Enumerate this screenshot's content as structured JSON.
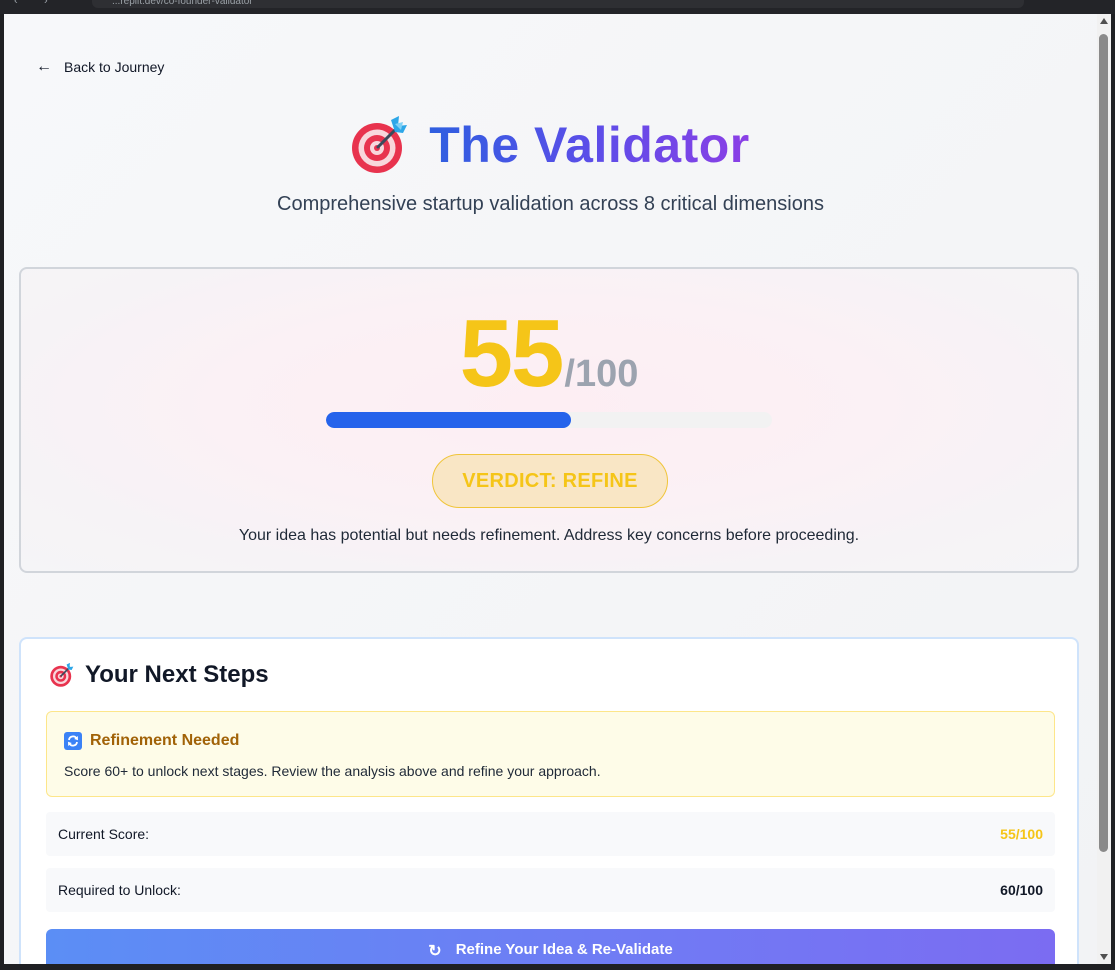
{
  "browser": {
    "url": "...replit.dev/co-founder-validator"
  },
  "nav": {
    "back_label": "Back to Journey"
  },
  "header": {
    "icon": "🎯",
    "title": "The Validator",
    "subtitle": "Comprehensive startup validation across 8 critical dimensions"
  },
  "score": {
    "value": "55",
    "denominator": "/100",
    "progress_fraction": 0.55,
    "verdict_label": "VERDICT: REFINE",
    "verdict_description": "Your idea has potential but needs refinement. Address key concerns before proceeding."
  },
  "next_steps": {
    "icon": "🎯",
    "title": "Your Next Steps",
    "refine_icon": "🔄",
    "refine_title": "Refinement Needed",
    "refine_text": "Score 60+ to unlock next stages. Review the analysis above and refine your approach.",
    "current_score_label": "Current Score:",
    "current_score_value": "55/100",
    "required_label": "Required to Unlock:",
    "required_value": "60/100",
    "cta_icon": "↻",
    "cta_label": "Refine Your Idea & Re-Validate"
  },
  "colors": {
    "score_yellow": "#f5c518",
    "progress_blue": "#2563eb",
    "title_gradient_start": "#2f5fe0",
    "title_gradient_end": "#8b3fe6",
    "refine_brown": "#a16207"
  }
}
